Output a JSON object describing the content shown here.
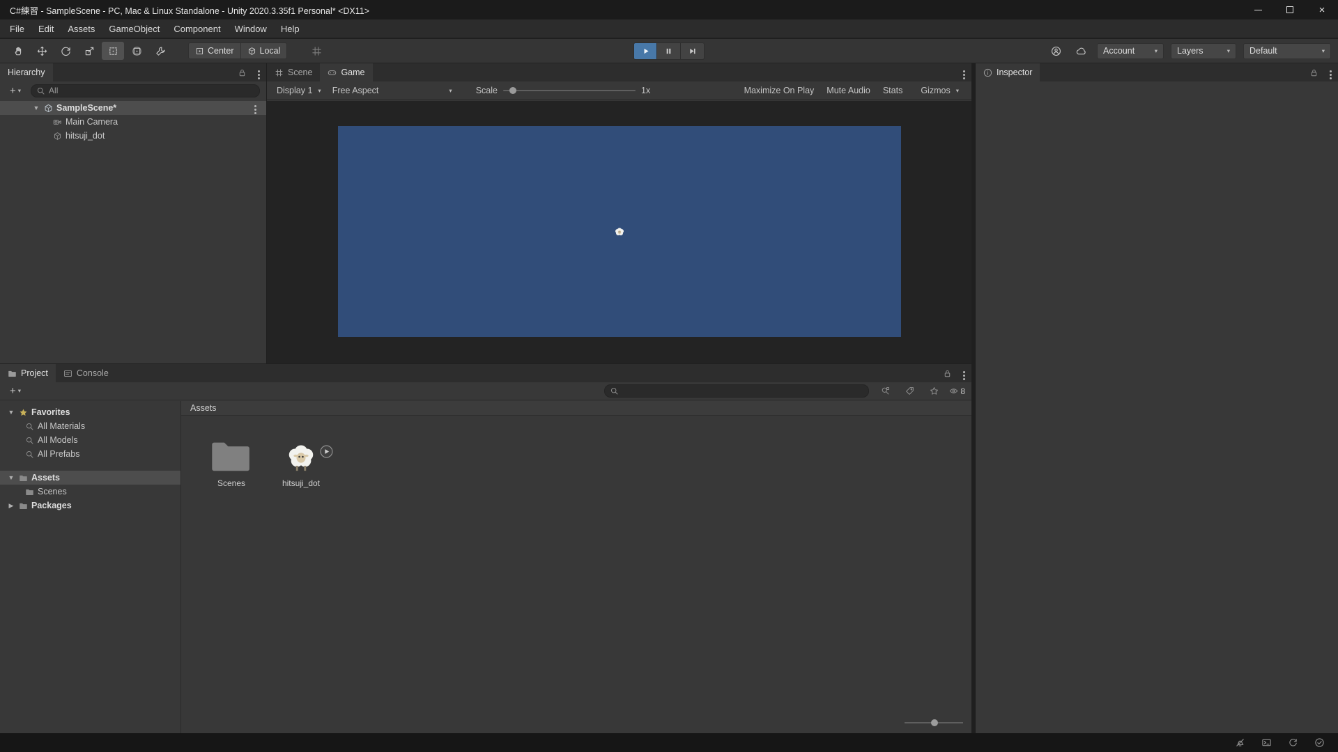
{
  "window": {
    "title": "C#練習 - SampleScene - PC, Mac & Linux Standalone - Unity 2020.3.35f1 Personal* <DX11>"
  },
  "icons": {
    "close": "×",
    "caret_down": "▾",
    "disclosure_open": "▼",
    "disclosure_closed": "▶"
  },
  "menubar": {
    "items": [
      "File",
      "Edit",
      "Assets",
      "GameObject",
      "Component",
      "Window",
      "Help"
    ]
  },
  "toolbar": {
    "pivot_label": "Center",
    "space_label": "Local",
    "account_label": "Account",
    "layers_label": "Layers",
    "layout_label": "Default"
  },
  "hierarchy": {
    "tab_label": "Hierarchy",
    "create_button": "+",
    "search_text": "All",
    "scene_label": "SampleScene*",
    "children": [
      "Main Camera",
      "hitsuji_dot"
    ]
  },
  "viewport": {
    "scene_tab": "Scene",
    "game_tab": "Game",
    "display_dropdown": "Display 1",
    "aspect_dropdown": "Free Aspect",
    "scale_label": "Scale",
    "scale_value": "1x",
    "maximize_button": "Maximize On Play",
    "mute_button": "Mute Audio",
    "stats_button": "Stats",
    "gizmos_button": "Gizmos",
    "game_background_color": "#314d79"
  },
  "project": {
    "project_tab": "Project",
    "console_tab": "Console",
    "create_button": "+",
    "hidden_packages_count": "8",
    "favorites_label": "Favorites",
    "favorites_items": [
      "All Materials",
      "All Models",
      "All Prefabs"
    ],
    "assets_label": "Assets",
    "assets_children": [
      "Scenes"
    ],
    "packages_label": "Packages",
    "breadcrumb": "Assets",
    "grid_items": [
      {
        "label": "Scenes",
        "type": "folder"
      },
      {
        "label": "hitsuji_dot",
        "type": "sprite"
      }
    ]
  },
  "inspector": {
    "tab_label": "Inspector"
  },
  "colors": {
    "selection_row": "#4d4d4d",
    "play_button_active": "#4878a8"
  }
}
